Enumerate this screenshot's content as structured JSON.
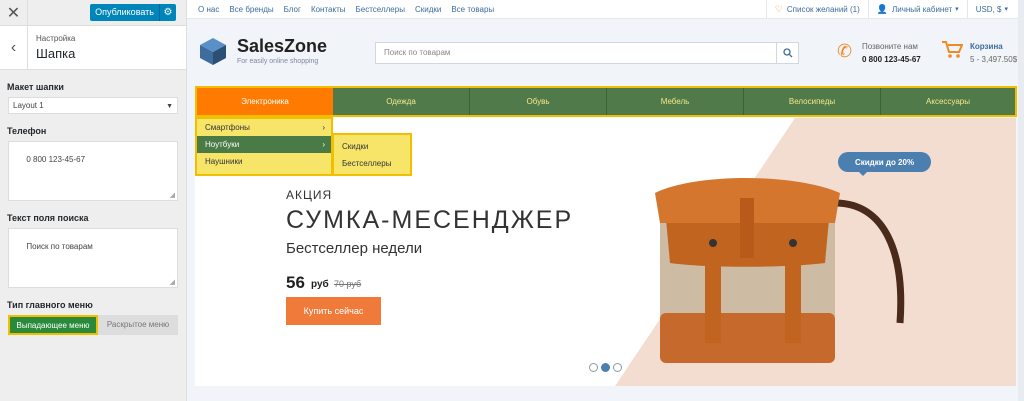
{
  "customizer": {
    "close": "✕",
    "publish_label": "Опубликовать",
    "gear": "⚙",
    "back": "‹",
    "section_subtitle": "Настройка",
    "section_title": "Шапка",
    "layout_label": "Макет шапки",
    "layout_value": "Layout 1",
    "phone_label": "Телефон",
    "phone_value": "0 800 123-45-67",
    "search_label": "Текст поля поиска",
    "search_value": "Поиск по товарам",
    "menu_type_label": "Тип главного меню",
    "menu_type_options": [
      "Выпадающее меню",
      "Раскрытое меню"
    ]
  },
  "topbar": {
    "links": [
      "О нас",
      "Все бренды",
      "Блог",
      "Контакты",
      "Бестселлеры",
      "Скидки",
      "Все товары"
    ],
    "wishlist": "Список желаний (1)",
    "account": "Личный кабинет",
    "currency": "USD, $"
  },
  "header": {
    "logo_name": "SalesZone",
    "logo_tagline": "For easily online shopping",
    "search_placeholder": "Поиск по товарам",
    "call_label": "Позвоните нам",
    "phone": "0 800 123-45-67",
    "cart_title": "Корзина",
    "cart_summary": "5 - 3,497.50$"
  },
  "nav": {
    "items": [
      "Электроника",
      "Одежда",
      "Обувь",
      "Мебель",
      "Велосипеды",
      "Аксессуары"
    ],
    "dropdown": [
      "Смартфоны",
      "Ноутбуки",
      "Наушники"
    ],
    "subdropdown": [
      "Скидки",
      "Бестселлеры"
    ]
  },
  "banner": {
    "kicker": "АКЦИЯ",
    "title": "СУМКА-МЕСЕНДЖЕР",
    "tagline": "Бестселлер недели",
    "price": "56",
    "currency": "руб",
    "old_price": "70 руб",
    "buy_label": "Купить сейчас",
    "badge": "Скидки до 20%",
    "slides": 3,
    "active_slide": 2
  },
  "colors": {
    "nav_bg": "#507a4a",
    "nav_active": "#ff7a00",
    "highlight": "#f0c000",
    "accent": "#f08a24",
    "link": "#3e6c9c"
  }
}
